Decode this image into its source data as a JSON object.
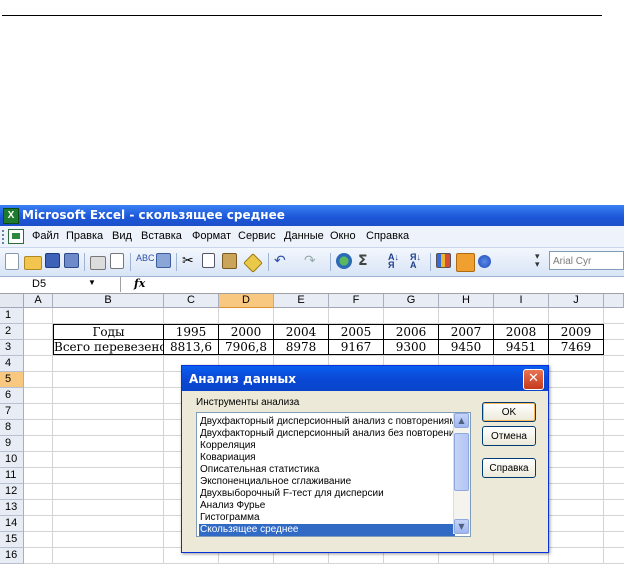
{
  "window": {
    "title": "Microsoft Excel - скользящее среднее",
    "app_icon": "excel-icon"
  },
  "menu": [
    "Файл",
    "Правка",
    "Вид",
    "Вставка",
    "Формат",
    "Сервис",
    "Данные",
    "Окно",
    "Справка"
  ],
  "toolbar": {
    "font_name": "Arial Cyr",
    "zoom_hint": ""
  },
  "formula_bar": {
    "name_box": "D5",
    "fx_label": "fx",
    "formula": ""
  },
  "columns": [
    "A",
    "B",
    "C",
    "D",
    "E",
    "F",
    "G",
    "H",
    "I",
    "J"
  ],
  "selected_column": "D",
  "rows": [
    "1",
    "2",
    "3",
    "4",
    "5",
    "6",
    "7",
    "8",
    "9",
    "10",
    "11",
    "12",
    "13",
    "14",
    "15",
    "16"
  ],
  "selected_row": "5",
  "sheet": {
    "row2": [
      "Годы",
      "1995",
      "2000",
      "2004",
      "2005",
      "2006",
      "2007",
      "2008",
      "2009"
    ],
    "row3": [
      "Всего перевезено",
      "8813,6",
      "7906,8",
      "8978",
      "9167",
      "9300",
      "9450",
      "9451",
      "7469"
    ]
  },
  "dialog": {
    "title": "Анализ данных",
    "tools_label": "Инструменты анализа",
    "items": [
      "Двухфакторный дисперсионный анализ с повторениями",
      "Двухфакторный дисперсионный анализ без повторений",
      "Корреляция",
      "Ковариация",
      "Описательная статистика",
      "Экспоненциальное сглаживание",
      "Двухвыборочный F-тест для дисперсии",
      "Анализ Фурье",
      "Гистограмма",
      "Скользящее среднее"
    ],
    "selected_item": "Скользящее среднее",
    "ok": "OK",
    "cancel": "Отмена",
    "help": "Справка",
    "close": "✕"
  }
}
